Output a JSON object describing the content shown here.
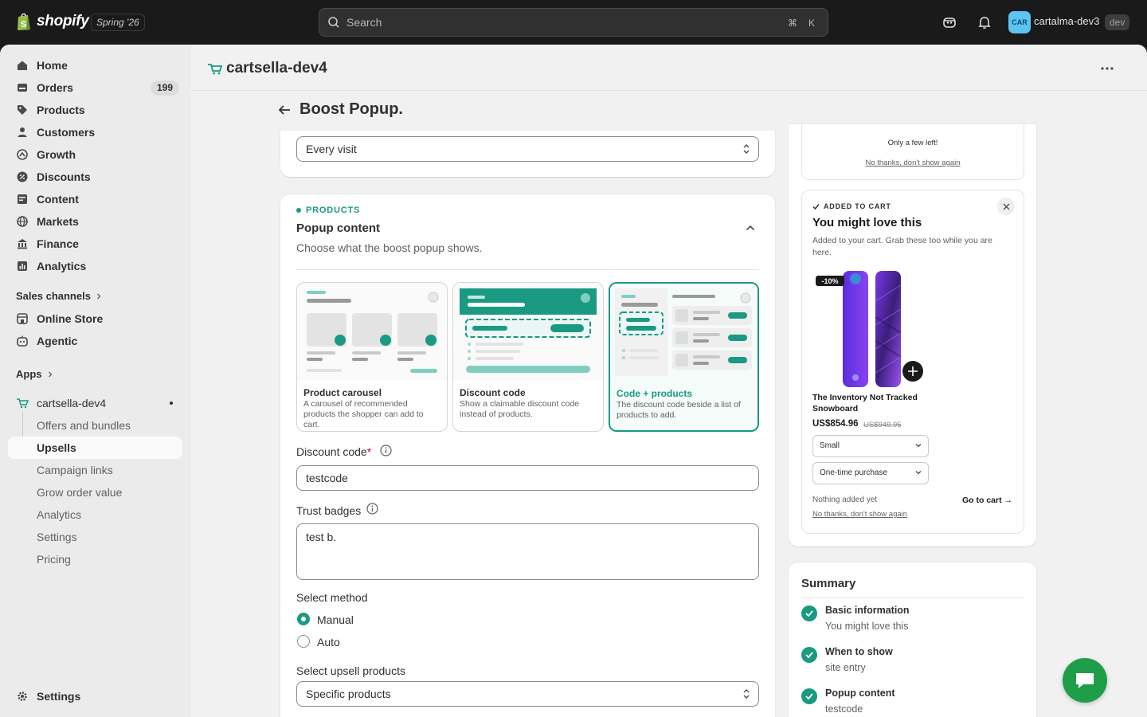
{
  "topbar": {
    "brand": "shopify",
    "edition": "Spring '26",
    "search_placeholder": "Search",
    "shortcut_cmd": "⌘",
    "shortcut_key": "K",
    "account_initials": "CAR",
    "account_name": "cartalma-dev3",
    "account_badge": "dev"
  },
  "sidebar": {
    "items": [
      {
        "label": "Home",
        "icon": "home-icon"
      },
      {
        "label": "Orders",
        "icon": "orders-icon",
        "badge": "199"
      },
      {
        "label": "Products",
        "icon": "tag-icon"
      },
      {
        "label": "Customers",
        "icon": "person-icon"
      },
      {
        "label": "Growth",
        "icon": "growth-icon"
      },
      {
        "label": "Discounts",
        "icon": "discount-icon"
      },
      {
        "label": "Content",
        "icon": "content-icon"
      },
      {
        "label": "Markets",
        "icon": "globe-icon"
      },
      {
        "label": "Finance",
        "icon": "bank-icon"
      },
      {
        "label": "Analytics",
        "icon": "chart-icon"
      }
    ],
    "sales_channels_label": "Sales channels",
    "channels": [
      {
        "label": "Online Store",
        "icon": "store-icon"
      },
      {
        "label": "Agentic",
        "icon": "agentic-icon"
      }
    ],
    "apps_label": "Apps",
    "app_name": "cartsella-dev4",
    "app_subitems": [
      "Offers and bundles",
      "Upsells",
      "Campaign links",
      "Grow order value",
      "Analytics",
      "Settings",
      "Pricing"
    ],
    "settings_label": "Settings"
  },
  "app": {
    "title": "cartsella-dev4"
  },
  "page": {
    "title": "Boost Popup."
  },
  "frequency": {
    "value": "Every visit"
  },
  "popup_content": {
    "tag": "PRODUCTS",
    "title": "Popup content",
    "subtitle": "Choose what the boost popup shows.",
    "options": [
      {
        "title": "Product carousel",
        "desc": "A carousel of recommended products the shopper can add to cart."
      },
      {
        "title": "Discount code",
        "desc": "Show a claimable discount code instead of products."
      },
      {
        "title": "Code + products",
        "desc": "The discount code beside a list of products to add."
      }
    ],
    "selected_option": "Code + products",
    "discount_label": "Discount code",
    "discount_required": "*",
    "discount_value": "testcode",
    "trust_label": "Trust badges",
    "trust_value": "test b.",
    "method_label": "Select method",
    "methods": [
      "Manual",
      "Auto"
    ],
    "method_selected": "Manual",
    "upsell_label": "Select upsell products",
    "upsell_value": "Specific products"
  },
  "preview": {
    "few_left": "Only a few left!",
    "no_thanks_top": "No thanks, don't show again",
    "added_tag": "ADDED TO CART",
    "title": "You might love this",
    "subtitle": "Added to your cart. Grab these too while you are here.",
    "discount_badge": "-10%",
    "product_name": "The Inventory Not Tracked Snowboard",
    "price": "US$854.96",
    "compare_price": "US$949.95",
    "variant": "Small",
    "purchase_type": "One-time purchase",
    "nothing_added": "Nothing added yet",
    "go_to_cart": "Go to cart →",
    "no_thanks_bottom": "No thanks, don't show again",
    "accent_color": "#1a9a82"
  },
  "summary": {
    "title": "Summary",
    "items": [
      {
        "heading": "Basic information",
        "value": "You might love this"
      },
      {
        "heading": "When to show",
        "value": "site entry"
      },
      {
        "heading": "Popup content",
        "value": "testcode"
      }
    ]
  }
}
